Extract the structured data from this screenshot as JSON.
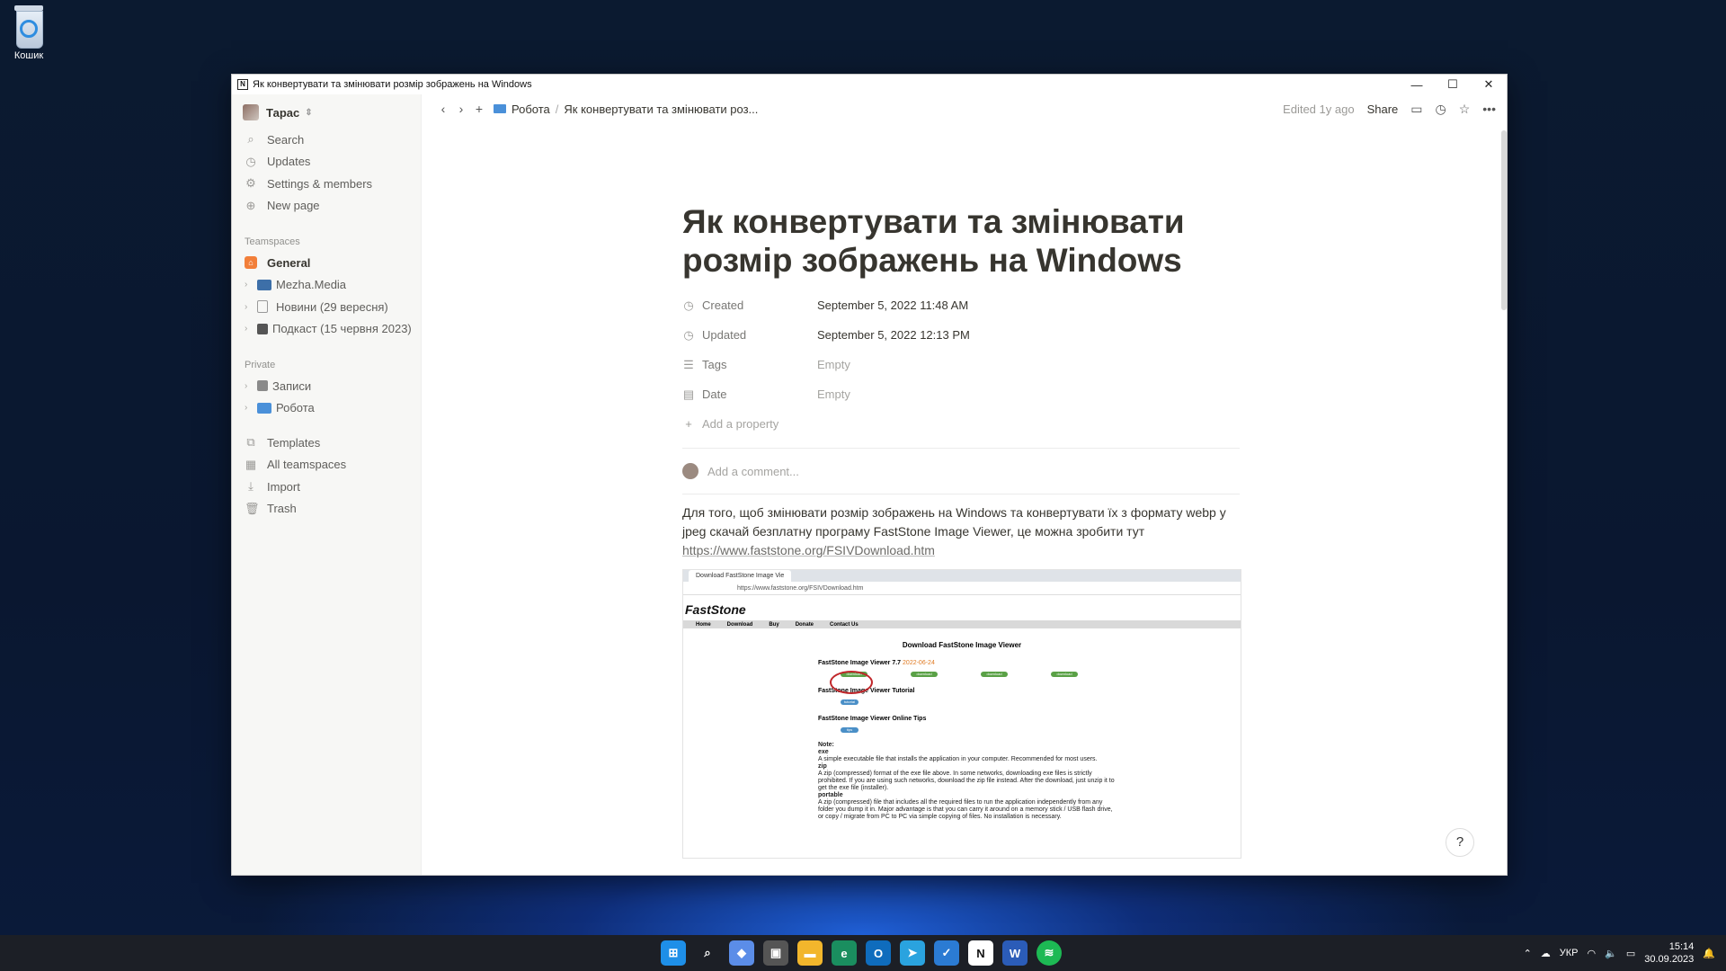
{
  "desktop": {
    "recycle_bin_label": "Кошик"
  },
  "window": {
    "title": "Як конвертувати та змінювати розмір зображень на Windows",
    "minimize": "—",
    "maximize": "☐",
    "close": "✕"
  },
  "sidebar": {
    "workspace": "Тарас",
    "nav": [
      {
        "label": "Search",
        "icon": "search-icon"
      },
      {
        "label": "Updates",
        "icon": "clock-icon"
      },
      {
        "label": "Settings & members",
        "icon": "gear-icon"
      },
      {
        "label": "New page",
        "icon": "plus-circle-icon"
      }
    ],
    "teamspaces_label": "Teamspaces",
    "teamspaces": [
      {
        "label": "General"
      },
      {
        "label": "Mezha.Media"
      },
      {
        "label": "Новини (29 вересня)"
      },
      {
        "label": "Подкаст (15 червня 2023)"
      }
    ],
    "private_label": "Private",
    "private": [
      {
        "label": "Записи"
      },
      {
        "label": "Робота"
      }
    ],
    "bottom": [
      {
        "label": "Templates"
      },
      {
        "label": "All teamspaces"
      },
      {
        "label": "Import"
      },
      {
        "label": "Trash"
      }
    ]
  },
  "topbar": {
    "crumb_parent": "Робота",
    "crumb_current": "Як конвертувати та змінювати роз...",
    "edited": "Edited 1y ago",
    "share": "Share"
  },
  "page": {
    "title": "Як конвертувати та змінювати розмір зображень на Windows",
    "properties": [
      {
        "name": "Created",
        "value": "September 5, 2022 11:48 AM"
      },
      {
        "name": "Updated",
        "value": "September 5, 2022 12:13 PM"
      },
      {
        "name": "Tags",
        "value": "Empty"
      },
      {
        "name": "Date",
        "value": "Empty"
      }
    ],
    "add_property": "Add a property",
    "comment_placeholder": "Add a comment...",
    "body_text": "Для того, щоб змінювати розмір зображень на Windows та конвертувати їх з формату webp у jpeg скачай безплатну програму FastStone Image Viewer, це можна зробити тут",
    "body_link": "https://www.faststone.org/FSIVDownload.htm",
    "embedded": {
      "tab": "Download FastStone Image Vie",
      "address": "https://www.faststone.org/FSIVDownload.htm",
      "logo": "FastStone",
      "menu": [
        "Home",
        "Download",
        "Buy",
        "Donate",
        "Contact Us"
      ],
      "heading": "Download FastStone Image Viewer",
      "product": "FastStone Image Viewer 7.7",
      "date": "2022-06-24",
      "download": "download",
      "tutorial_heading": "FastStone Image Viewer Tutorial",
      "tutorial": "tutorial",
      "tips_heading": "FastStone Image Viewer Online Tips",
      "tips": "tips",
      "note": "Note:",
      "exe": "exe",
      "exe_desc": "A simple executable file that installs the application in your computer. Recommended for most users.",
      "zip": "zip",
      "zip_desc": "A zip (compressed) format of the exe file above. In some networks, downloading exe files is strictly prohibited. If you are using such networks, download the zip file instead. After the download, just unzip it to get the exe file (installer).",
      "portable": "portable",
      "portable_desc": "A zip (compressed) file that includes all the required files to run the application independently from any folder you dump it in. Major advantage is that you can carry it around on a memory stick / USB flash drive, or copy / migrate from PC to PC via simple copying of files. No installation is necessary."
    },
    "help": "?"
  },
  "taskbar": {
    "lang": "УКР",
    "time": "15:14",
    "date": "30.09.2023"
  }
}
